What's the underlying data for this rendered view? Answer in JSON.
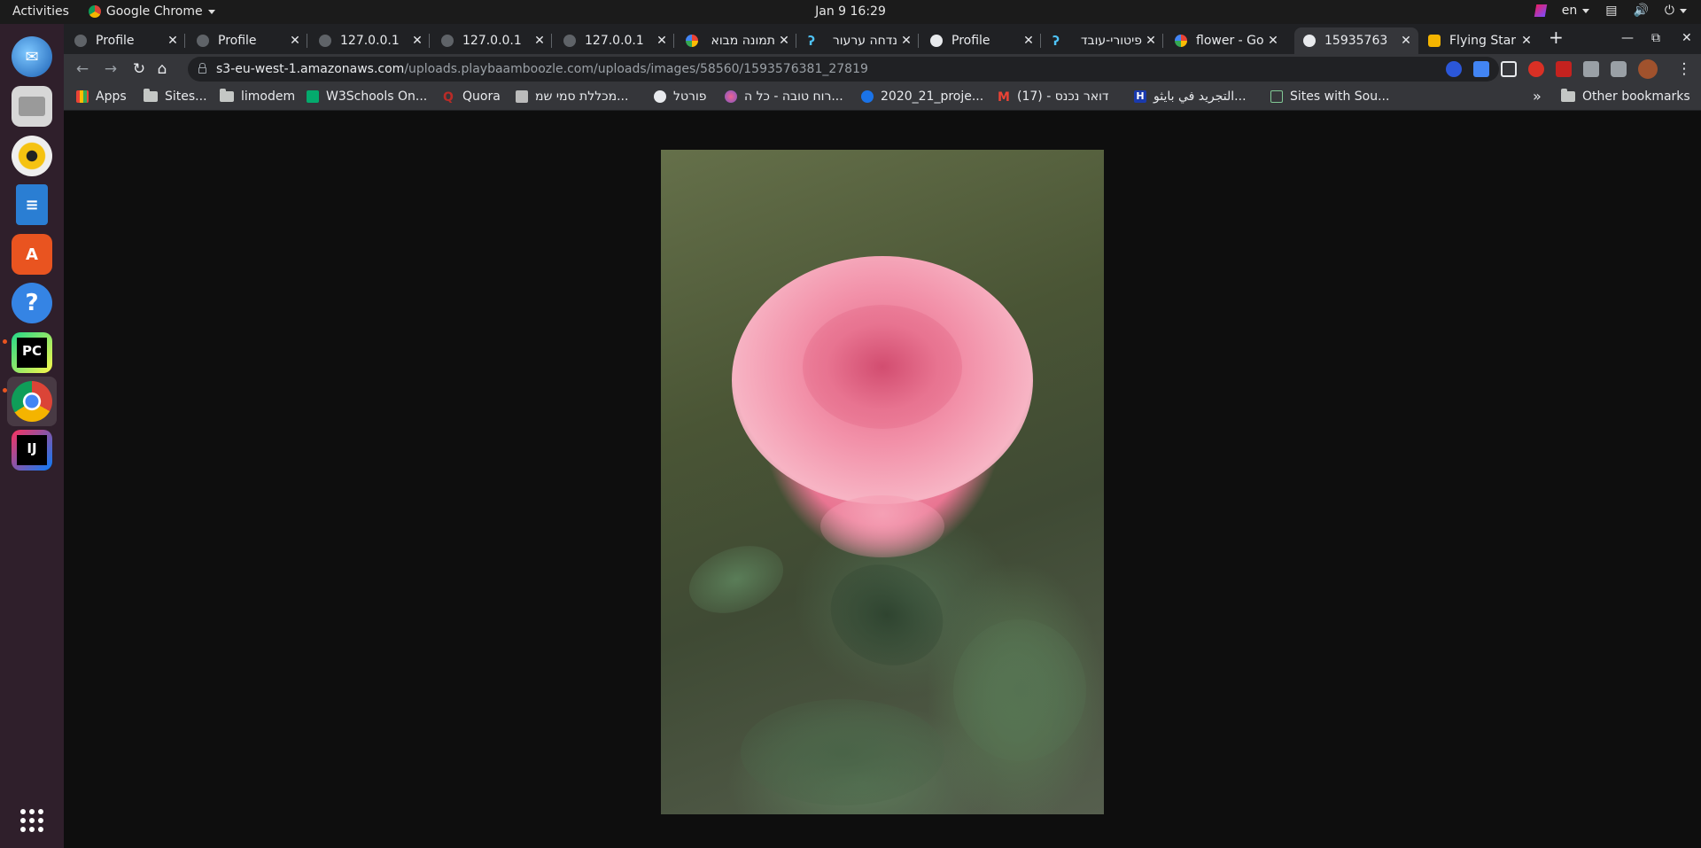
{
  "os": {
    "activities": "Activities",
    "app_menu": "Google Chrome",
    "clock": "Jan 9  16:29",
    "lang": "en"
  },
  "tabs": [
    {
      "title": "Profile",
      "active": false
    },
    {
      "title": "Profile",
      "active": false
    },
    {
      "title": "127.0.0.1",
      "active": false
    },
    {
      "title": "127.0.0.1",
      "active": false
    },
    {
      "title": "127.0.0.1",
      "active": false
    },
    {
      "title": "תמונה מבוא",
      "active": false
    },
    {
      "title": "נדחה ערעור",
      "active": false
    },
    {
      "title": "Profile",
      "active": false
    },
    {
      "title": "פיטורי-עובד",
      "active": false
    },
    {
      "title": "flower - Go",
      "active": false
    },
    {
      "title": "15935763",
      "active": true
    },
    {
      "title": "Flying Star",
      "active": false
    }
  ],
  "address": {
    "host": "s3-eu-west-1.amazonaws.com",
    "path": "/uploads.playbaamboozle.com/uploads/images/58560/1593576381_27819"
  },
  "bookmarks": [
    "Apps",
    "Sites...",
    "limodem",
    "W3Schools On...",
    "Quora",
    "מכללת סמי שמ...",
    "פורטל",
    "רוח טובה - כל ה...",
    "2020_21_proje...",
    "דואר נכנס - (17)",
    "التجريد في بايثو...",
    "Sites with Sou..."
  ],
  "bookmarks_overflow": "»",
  "other_bookmarks": "Other bookmarks",
  "colors": {
    "tab_strip": "#202124",
    "toolbar": "#35363a",
    "dock": "#2f1f2b",
    "accent": "#8ab4f8"
  }
}
